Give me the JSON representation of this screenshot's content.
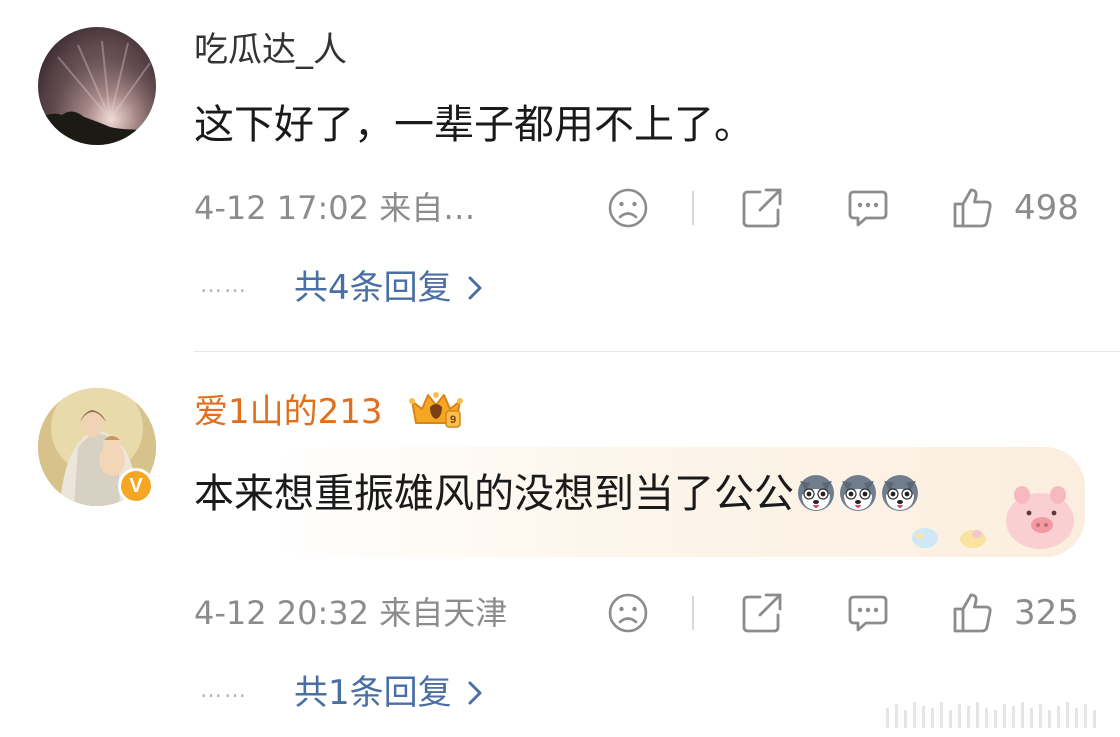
{
  "comments": [
    {
      "username": "吃瓜达_人",
      "text": "这下好了，一辈子都用不上了。",
      "time_source": "4-12 17:02  来自…",
      "likes": "498",
      "replies_label": "共4条回复",
      "replies_dots": "……",
      "avatar_icon": "sunset-avatar",
      "username_color": "#333333"
    },
    {
      "username": "爱1山的213",
      "text": "本来想重振雄风的没想到当了公公",
      "emojis": [
        "husky-emoji",
        "husky-emoji",
        "husky-emoji"
      ],
      "time_source": "4-12 20:32  来自天津",
      "likes": "325",
      "replies_label": "共1条回复",
      "replies_dots": "……",
      "avatar_icon": "madonna-painting-avatar",
      "verified_icon": "verified-v-badge",
      "vip_icon": "vip-crown-badge",
      "username_color": "#e0701d",
      "bubble_decoration": "pink-pig-bubble"
    }
  ],
  "icons": {
    "dislike": "sad-face-icon",
    "share": "share-icon",
    "comment": "comment-icon",
    "like": "thumbs-up-icon",
    "chevron": "chevron-right-icon"
  },
  "colors": {
    "link": "#4a6fa5",
    "meta": "#8c8c8c",
    "verified": "#f5a623"
  }
}
